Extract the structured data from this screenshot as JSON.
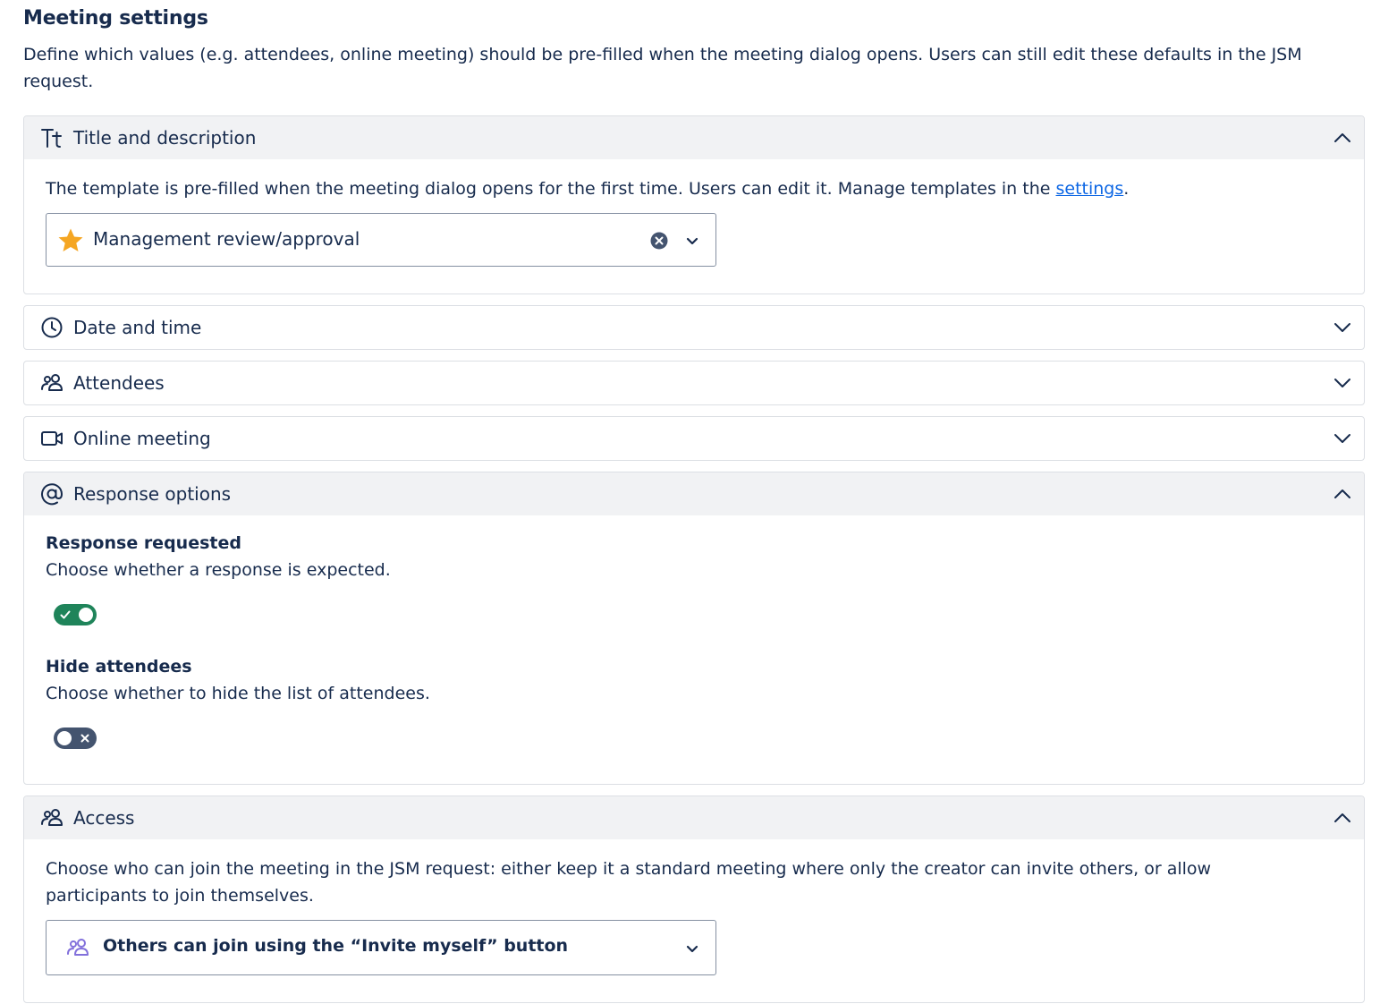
{
  "header": {
    "title": "Meeting settings",
    "description": "Define which values (e.g. attendees, online meeting) should be pre-filled when the meeting dialog opens. Users can still edit these defaults in the JSM request."
  },
  "sections": {
    "title_description": {
      "label": "Title and description",
      "icon": "text-format-icon",
      "expanded": true,
      "text_before_link": "The template is pre-filled when the meeting dialog opens for the first time. Users can edit it. Manage templates in the ",
      "link_text": "settings",
      "text_after_link": ".",
      "template_select": {
        "value": "Management review/approval",
        "icon": "star-icon"
      }
    },
    "date_time": {
      "label": "Date and time",
      "icon": "clock-icon",
      "expanded": false
    },
    "attendees": {
      "label": "Attendees",
      "icon": "people-icon",
      "expanded": false
    },
    "online_meeting": {
      "label": "Online meeting",
      "icon": "video-camera-icon",
      "expanded": false
    },
    "response_options": {
      "label": "Response options",
      "icon": "at-sign-icon",
      "expanded": true,
      "response_requested": {
        "title": "Response requested",
        "description": "Choose whether a response is expected.",
        "enabled": true
      },
      "hide_attendees": {
        "title": "Hide attendees",
        "description": "Choose whether to hide the list of attendees.",
        "enabled": false
      }
    },
    "access": {
      "label": "Access",
      "icon": "people-icon",
      "expanded": true,
      "description": "Choose who can join the meeting in the JSM request: either keep it a standard meeting where only the creator can invite others, or allow participants to join themselves.",
      "access_select": {
        "value": "Others can join using the “Invite myself” button",
        "icon": "people-icon"
      }
    }
  },
  "colors": {
    "text": "#172b4d",
    "link": "#0c66e4",
    "toggle_on": "#22a06b",
    "toggle_off": "#44546f",
    "star": "#f5a623",
    "access_icon": "#8270db"
  }
}
